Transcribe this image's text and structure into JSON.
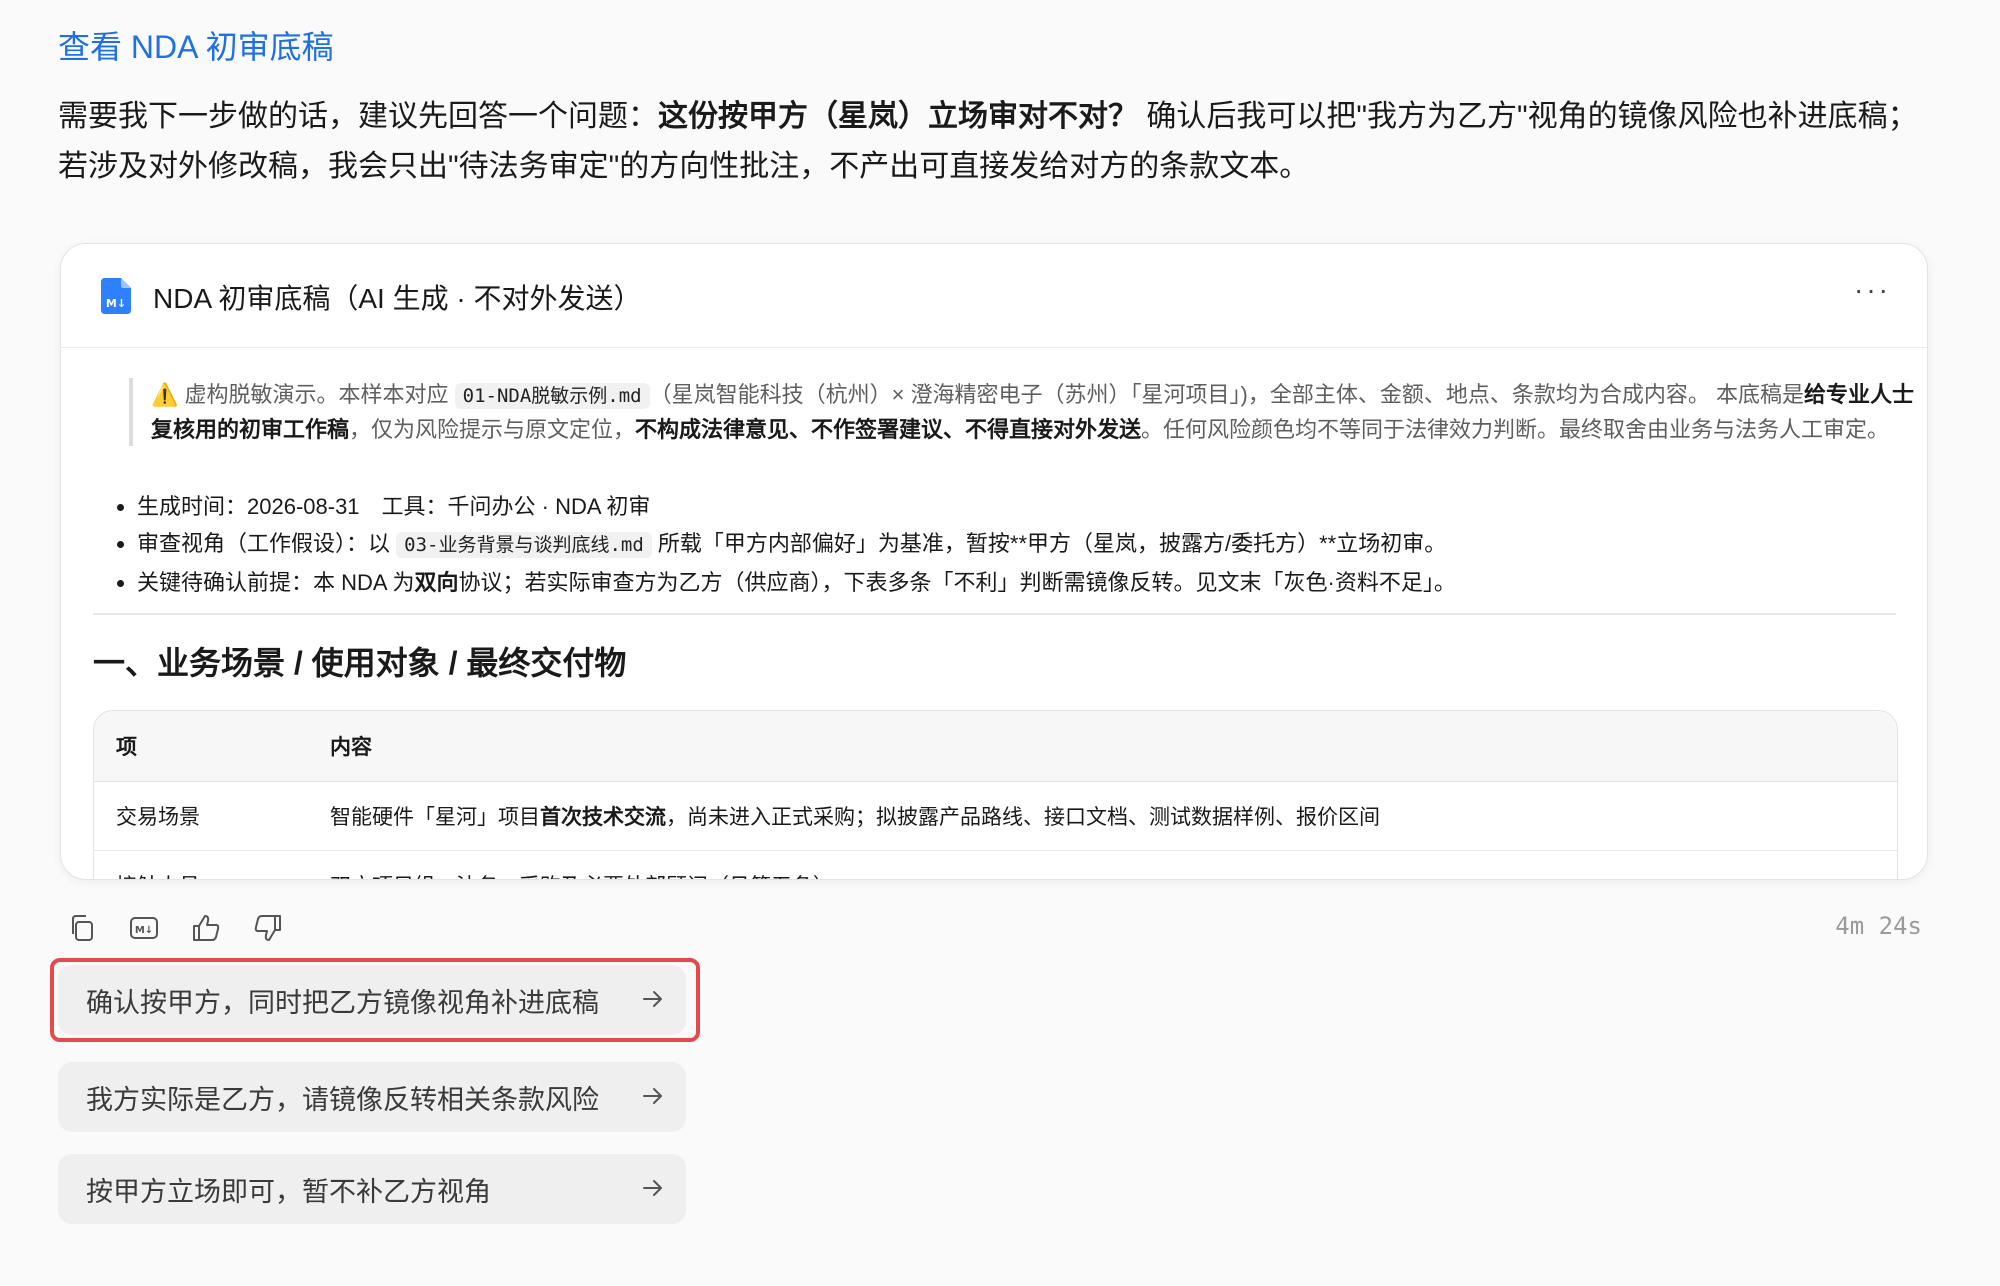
{
  "top_link": "查看 NDA 初审底稿",
  "intro": {
    "part1": "需要我下一步做的话，建议先回答一个问题：",
    "bold": "这份按甲方（星岚）立场审对不对？",
    "part2": " 确认后我可以把\"我方为乙方\"视角的镜像风险也补进底稿；若涉及对外修改稿，我会只出\"待法务审定\"的方向性批注，不产出可直接发给对方的条款文本。"
  },
  "card": {
    "icon": "markdown-file-icon",
    "title": "NDA 初审底稿（AI 生成 · 不对外发送）",
    "more_label": "···",
    "quote": {
      "p1": "⚠️ 虚构脱敏演示。本样本对应 ",
      "code1": "01-NDA脱敏示例.md",
      "p2": "（星岚智能科技（杭州）× 澄海精密电子（苏州）「星河项目」)，全部主体、金额、地点、条款均为合成内容。 本底稿是",
      "b1": "给专业人士复核用的初审工作稿",
      "p3": "，仅为风险提示与原文定位，",
      "b2": "不构成法律意见、不作签署建议、不得直接对外发送",
      "p4": "。任何风险颜色均不等同于法律效力判断。最终取舍由业务与法务人工审定。"
    },
    "bullets": {
      "b1": "生成时间：2026-08-31　工具：千问办公 · NDA 初审",
      "b2_pre": "审查视角（工作假设）：以 ",
      "b2_code": "03-业务背景与谈判底线.md",
      "b2_post": " 所载「甲方内部偏好」为基准，暂按**甲方（星岚，披露方/委托方）**立场初审。",
      "b3_pre": "关键待确认前提：本 NDA 为",
      "b3_bold": "双向",
      "b3_post": "协议；若实际审查方为乙方（供应商），下表多条「不利」判断需镜像反转。见文末「灰色·资料不足」。"
    },
    "section_title": "一、业务场景 / 使用对象 / 最终交付物",
    "table": {
      "headers": [
        "项",
        "内容"
      ],
      "row1": {
        "col1": "交易场景",
        "pre": "智能硬件「星河」项目",
        "bold": "首次技术交流",
        "post": "，尚未进入正式采购；拟披露产品路线、接口文档、测试数据样例、报价区间"
      },
      "row2": {
        "col1": "接触人员",
        "col2": "双方项目组、法务、采购及必要外部顾问（见第五条）"
      }
    }
  },
  "actions": {
    "copy": "copy-icon",
    "markdown": "markdown-icon",
    "like": "thumbs-up-icon",
    "dislike": "thumbs-down-icon"
  },
  "elapsed": "4m 24s",
  "suggestions": [
    {
      "label": "确认按甲方，同时把乙方镜像视角补进底稿"
    },
    {
      "label": "我方实际是乙方，请镜像反转相关条款风险"
    },
    {
      "label": "按甲方立场即可，暂不补乙方视角"
    }
  ],
  "colors": {
    "link": "#1f6fe5",
    "highlight": "#e5484d",
    "suggestion_bg": "#efefef"
  }
}
